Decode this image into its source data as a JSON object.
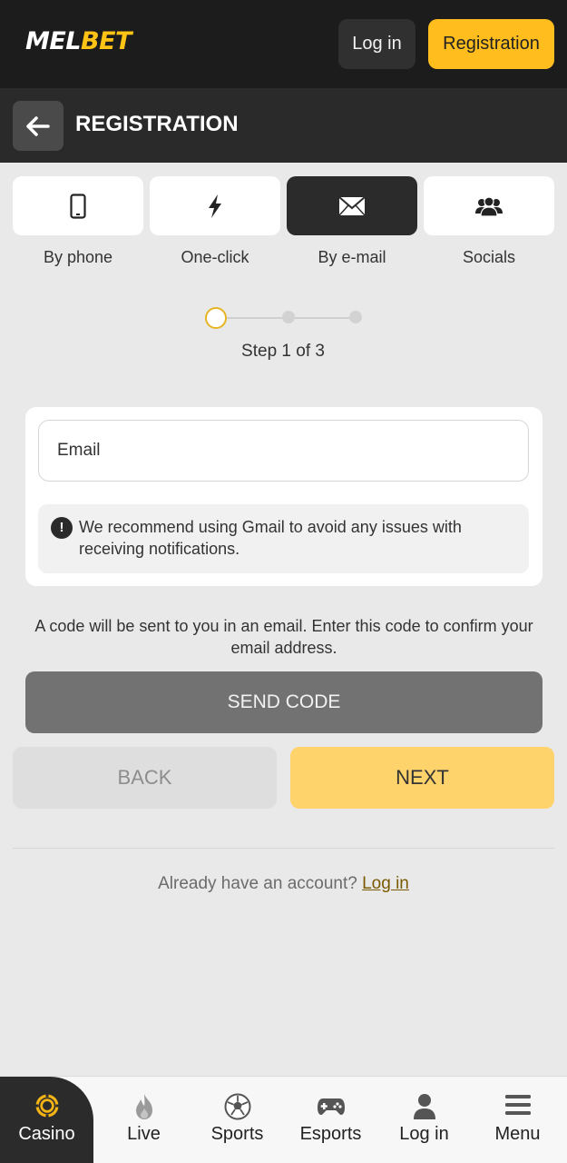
{
  "header": {
    "logo_part1": "MEL",
    "logo_part2": "BET",
    "login_label": "Log in",
    "register_label": "Registration"
  },
  "titlebar": {
    "title": "REGISTRATION",
    "back_icon": "arrow-left-icon"
  },
  "methods": [
    {
      "label": "By phone",
      "icon": "phone-icon",
      "active": false
    },
    {
      "label": "One-click",
      "icon": "lightning-icon",
      "active": false
    },
    {
      "label": "By e-mail",
      "icon": "envelope-icon",
      "active": true
    },
    {
      "label": "Socials",
      "icon": "people-icon",
      "active": false
    }
  ],
  "stepper": {
    "current": 1,
    "total": 3,
    "text": "Step 1 of 3"
  },
  "form": {
    "email_placeholder": "Email",
    "email_value": "",
    "notice": "We recommend using Gmail to avoid any issues with receiving notifications."
  },
  "info_text": "A code will be sent to you in an email. Enter this code to confirm your email address.",
  "buttons": {
    "send_code": "SEND CODE",
    "back": "BACK",
    "next": "NEXT"
  },
  "footer": {
    "already_text": "Already have an account?",
    "login_link": "Log in"
  },
  "bottom_nav": [
    {
      "label": "Casino",
      "icon": "casino-chip-icon",
      "active": true
    },
    {
      "label": "Live",
      "icon": "flame-icon",
      "active": false
    },
    {
      "label": "Sports",
      "icon": "soccer-ball-icon",
      "active": false
    },
    {
      "label": "Esports",
      "icon": "gamepad-icon",
      "active": false
    },
    {
      "label": "Log in",
      "icon": "user-icon",
      "active": false
    },
    {
      "label": "Menu",
      "icon": "hamburger-menu-icon",
      "active": false
    }
  ],
  "colors": {
    "brand_yellow": "#ffbe1e",
    "header_bg": "#1c1c1c",
    "next_button": "#ffd36c",
    "send_button": "#727272"
  }
}
